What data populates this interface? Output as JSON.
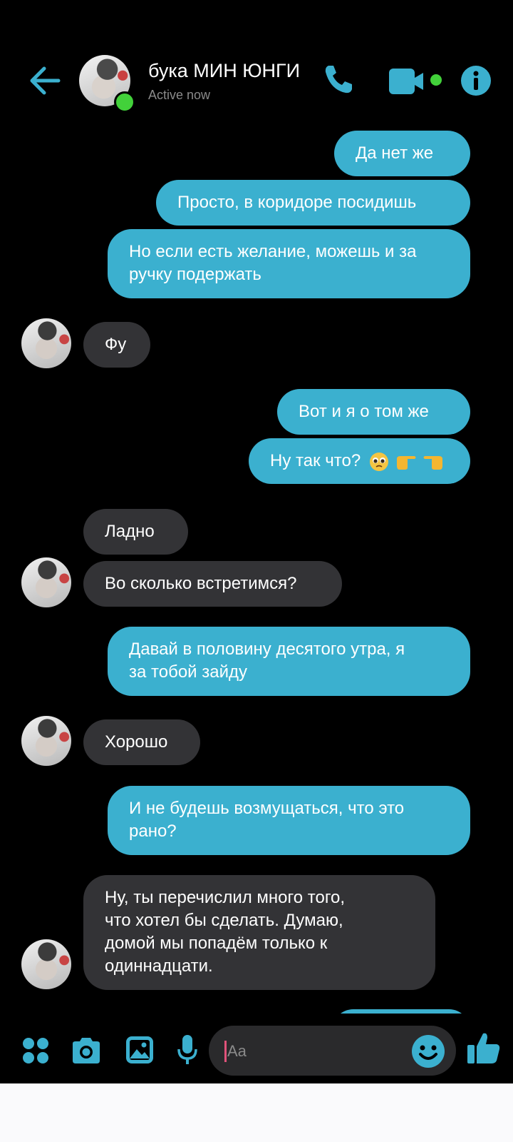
{
  "colors": {
    "accent": "#3bb0cf",
    "incoming_bubble": "#333336",
    "online": "#42d13a",
    "background": "#000000"
  },
  "header": {
    "contact_name": "бука МИН ЮНГИ",
    "status": "Active now",
    "icons": [
      "back-arrow-icon",
      "phone-icon",
      "video-camera-icon",
      "info-icon"
    ]
  },
  "messages": [
    {
      "from": "me",
      "text": "Да нет же"
    },
    {
      "from": "me",
      "text": "Просто, в коридоре посидишь"
    },
    {
      "from": "me",
      "lines": [
        "Но если есть желание, можешь и за",
        "ручку подержать"
      ]
    },
    {
      "from": "them",
      "text": "Фу"
    },
    {
      "from": "me",
      "text": "Вот и я о том же"
    },
    {
      "from": "me",
      "text": "Ну так что?",
      "emoji": [
        "pleading-face",
        "backhand-index-pointing-right",
        "backhand-index-pointing-left"
      ]
    },
    {
      "from": "them",
      "text": "Ладно"
    },
    {
      "from": "them",
      "text": "Во сколько встретимся?"
    },
    {
      "from": "me",
      "lines": [
        "Давай в половину десятого утра, я",
        "за тобой зайду"
      ]
    },
    {
      "from": "them",
      "text": "Хорошо"
    },
    {
      "from": "me",
      "lines": [
        "И не будешь возмущаться, что это",
        "рано?"
      ]
    },
    {
      "from": "them",
      "lines": [
        "Ну, ты перечислил много того,",
        "что хотел бы сделать. Думаю,",
        "домой мы попадём только к",
        "одиннадцати."
      ]
    }
  ],
  "composer": {
    "placeholder": "Aa",
    "icons": [
      "more-apps-icon",
      "camera-icon",
      "gallery-icon",
      "microphone-icon",
      "emoji-icon",
      "like-icon"
    ]
  }
}
